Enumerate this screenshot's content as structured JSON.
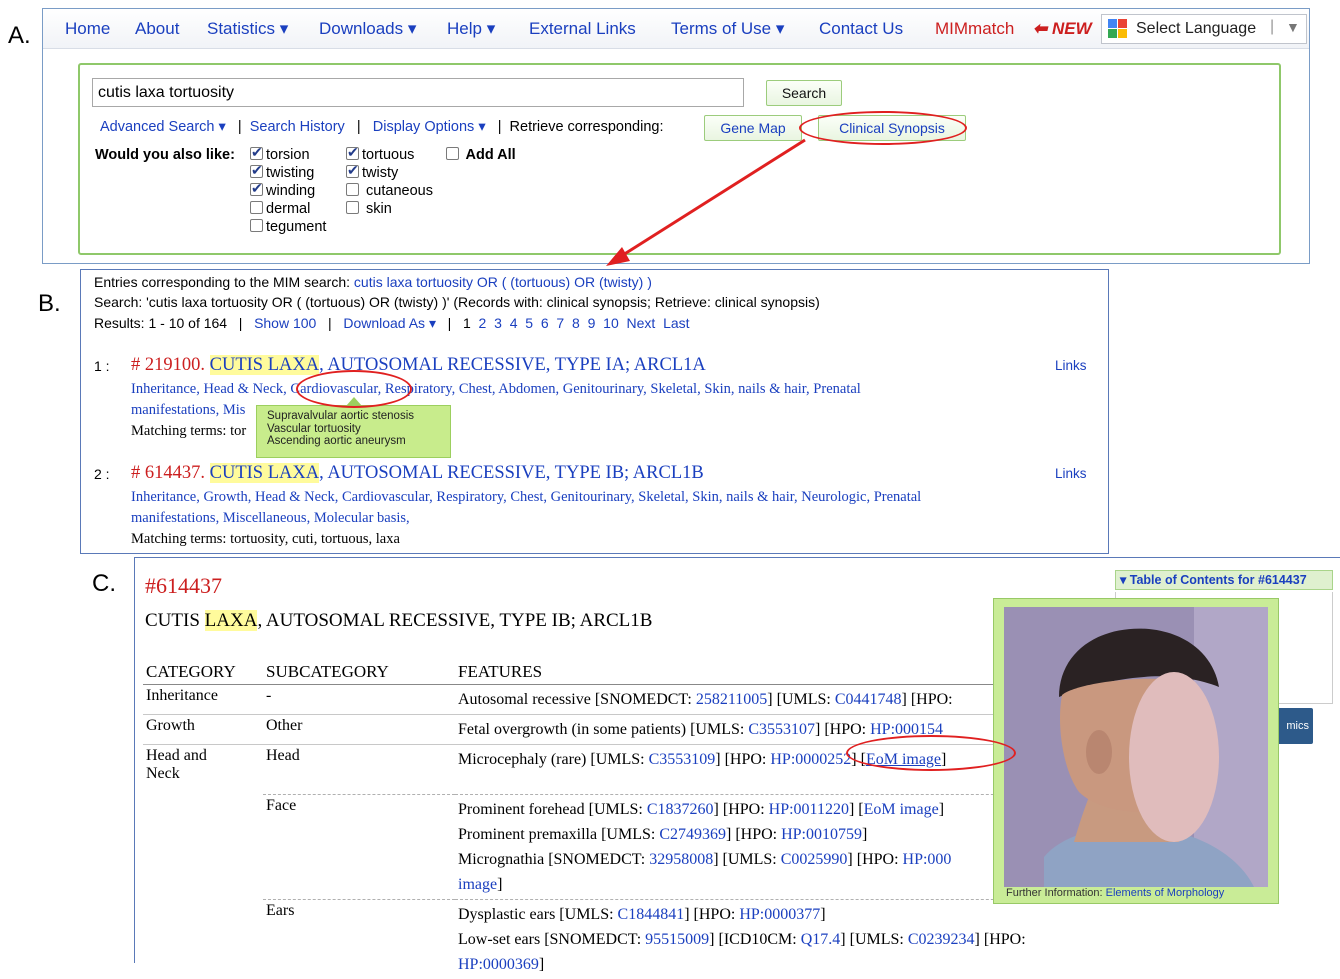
{
  "panel_labels": {
    "a": "A.",
    "b": "B.",
    "c": "C."
  },
  "navbar": {
    "items": [
      "Home",
      "About",
      "Statistics",
      "Downloads",
      "Help",
      "External Links",
      "Terms of Use",
      "Contact Us"
    ],
    "mimmatch": "MIMmatch",
    "new_badge": "NEW",
    "language": "Select Language"
  },
  "search": {
    "query": "cutis laxa tortuosity",
    "button": "Search",
    "advanced": "Advanced Search",
    "history": "Search History",
    "display": "Display Options",
    "retrieve_label": "Retrieve corresponding:",
    "gene_map": "Gene Map",
    "clinical_synopsis": "Clinical Synopsis",
    "also_like": "Would you also like:",
    "add_all": "Add All",
    "terms": [
      {
        "label": "torsion",
        "checked": true
      },
      {
        "label": "tortuous",
        "checked": true
      },
      {
        "label": "twisting",
        "checked": true
      },
      {
        "label": "twisty",
        "checked": true
      },
      {
        "label": "winding",
        "checked": true
      },
      {
        "label": "cutaneous",
        "checked": false
      },
      {
        "label": "dermal",
        "checked": false
      },
      {
        "label": "skin",
        "checked": false
      },
      {
        "label": "tegument",
        "checked": false
      }
    ]
  },
  "results": {
    "corresponding_prefix": "Entries corresponding to the MIM search:",
    "corresponding_query": "cutis laxa tortuosity OR ( (tortuous) OR (twisty) )",
    "search_line": "Search: 'cutis laxa tortuosity OR ( (tortuous) OR (twisty) )' (Records with: clinical synopsis; Retrieve: clinical synopsis)",
    "count": "Results: 1 - 10 of 164",
    "show": "Show 100",
    "download": "Download As",
    "pages": [
      "1",
      "2",
      "3",
      "4",
      "5",
      "6",
      "7",
      "8",
      "9",
      "10"
    ],
    "next": "Next",
    "last": "Last",
    "links_label": "Links",
    "entries": [
      {
        "index": "1 :",
        "number": "# 219100.",
        "title_hl": "CUTIS LAXA",
        "title_rest": ", AUTOSOMAL RECESSIVE, TYPE IA; ARCL1A",
        "cats1": "Inheritance, Head & Neck, Cardiovascular, Respiratory, Chest, Abdomen, Genitourinary, Skeletal, Skin, nails & hair, Prenatal",
        "cats2": "manifestations, Mis",
        "matching": "Matching terms: tor"
      },
      {
        "index": "2 :",
        "number": "# 614437.",
        "title_hl": "CUTIS LAXA",
        "title_rest": ", AUTOSOMAL RECESSIVE, TYPE IB; ARCL1B",
        "cats1": "Inheritance, Growth, Head & Neck, Cardiovascular, Respiratory, Chest, Genitourinary, Skeletal, Skin, nails & hair, Neurologic, Prenatal",
        "cats2": "manifestations, Miscellaneous, Molecular basis,",
        "matching": "Matching terms: tortuosity, cuti, tortuous, laxa"
      }
    ],
    "tooltip": [
      "Supravalvular aortic stenosis",
      "Vascular tortuosity",
      "Ascending aortic aneurysm"
    ]
  },
  "synopsis": {
    "id": "#614437",
    "title_hl": "LAXA",
    "title_pre": "CUTIS ",
    "title_post": ", AUTOSOMAL RECESSIVE, TYPE IB; ARCL1B",
    "headers": [
      "CATEGORY",
      "SUBCATEGORY",
      "FEATURES"
    ],
    "rows": {
      "inheritance": {
        "cat": "Inheritance",
        "sub": "-",
        "pre": "Autosomal recessive [SNOMEDCT: ",
        "l1": "258211005",
        "mid": "] [UMLS: ",
        "l2": "C0441748",
        "post": "] [HPO:"
      },
      "growth": {
        "cat": "Growth",
        "sub": "Other",
        "pre": "Fetal overgrowth (in some patients) [UMLS: ",
        "l1": "C3553107",
        "mid": "] [HPO: ",
        "l2": "HP:000154"
      },
      "head": {
        "cat1": "Head and",
        "cat2": "Neck",
        "sub": "Head",
        "pre": "Microcephaly (rare) [UMLS: ",
        "l1": "C3553109",
        "mid": "] [HPO: ",
        "l2": "HP:0000252",
        "mid2": "] [",
        "l3": "EoM image",
        "post": "]"
      },
      "face": {
        "sub": "Face",
        "f1_pre": "Prominent forehead [UMLS: ",
        "f1_l1": "C1837260",
        "f1_mid": "] [HPO: ",
        "f1_l2": "HP:0011220",
        "f1_mid2": "] [",
        "f1_l3": "EoM image",
        "f1_post": "]",
        "f2_pre": "Prominent premaxilla [UMLS: ",
        "f2_l1": "C2749369",
        "f2_mid": "] [HPO: ",
        "f2_l2": "HP:0010759",
        "f2_post": "]",
        "f3_pre": "Micrognathia [SNOMEDCT: ",
        "f3_l1": "32958008",
        "f3_mid": "] [UMLS: ",
        "f3_l2": "C0025990",
        "f3_mid2": "] [HPO: ",
        "f3_l3": "HP:000",
        "f4_l": "image",
        "f4_post": "]"
      },
      "ears": {
        "sub": "Ears",
        "e1_pre": "Dysplastic ears [UMLS: ",
        "e1_l1": "C1844841",
        "e1_mid": "] [HPO: ",
        "e1_l2": "HP:0000377",
        "e1_post": "]",
        "e2_pre": "Low-set ears [SNOMEDCT: ",
        "e2_l1": "95515009",
        "e2_mid": "] [ICD10CM: ",
        "e2_l2": "Q17.4",
        "e2_mid2": "] [UMLS: ",
        "e2_l3": "C0239234",
        "e2_post": "] [HPO:",
        "e3_l": "HP:0000369",
        "e3_post": "]"
      }
    },
    "toc": "Table of Contents for #614437",
    "genomics": "mics",
    "photo_caption_pre": "Further Information: ",
    "photo_caption_link": "Elements of Morphology"
  },
  "colors": {
    "link": "#1a3fbf",
    "mim_number": "#cc1f1f",
    "highlight": "#fffb9c",
    "annotation": "#e02020",
    "green_border": "#8fc86a"
  }
}
